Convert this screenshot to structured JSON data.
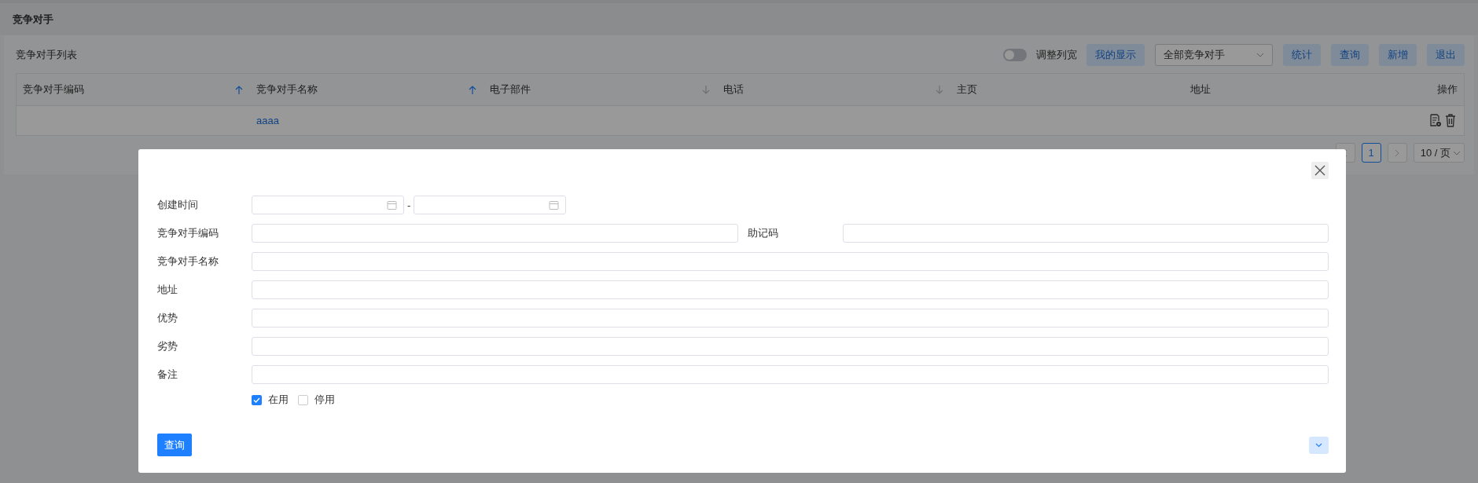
{
  "page": {
    "title": "竞争对手"
  },
  "list": {
    "title": "竞争对手列表",
    "toolbar": {
      "toggle": {
        "label": "调整列宽",
        "on": false
      },
      "display_button": "我的显示",
      "filter_select": {
        "value": "全部竞争对手"
      },
      "buttons": [
        "统计",
        "查询",
        "新增",
        "退出"
      ]
    },
    "table": {
      "columns": [
        {
          "label": "竞争对手编码",
          "ascending": true,
          "active": true
        },
        {
          "label": "竞争对手名称",
          "ascending": true,
          "active": true
        },
        {
          "label": "电子部件",
          "ascending": false,
          "active": false
        },
        {
          "label": "电话",
          "ascending": false,
          "active": false
        },
        {
          "label": "主页"
        },
        {
          "label": "地址"
        },
        {
          "label": "操作"
        }
      ],
      "rows": [
        {
          "name": "aaaa"
        }
      ]
    },
    "pagination": {
      "pages": [
        {
          "label": "1",
          "selected": true
        }
      ],
      "page_size": "10 / 页"
    }
  },
  "modal": {
    "fields": [
      {
        "kind": "date_range",
        "label": "创建时间",
        "separator": "-"
      },
      {
        "kind": "pair",
        "label": "竞争对手编码",
        "label2": "助记码"
      },
      {
        "kind": "text",
        "label": "竞争对手名称"
      },
      {
        "kind": "text",
        "label": "地址"
      },
      {
        "kind": "text",
        "label": "优势"
      },
      {
        "kind": "text",
        "label": "劣势"
      },
      {
        "kind": "text",
        "label": "备注"
      }
    ],
    "status_options": [
      {
        "label": "在用",
        "checked": true
      },
      {
        "label": "停用",
        "checked": false
      }
    ],
    "submit": "查询"
  }
}
